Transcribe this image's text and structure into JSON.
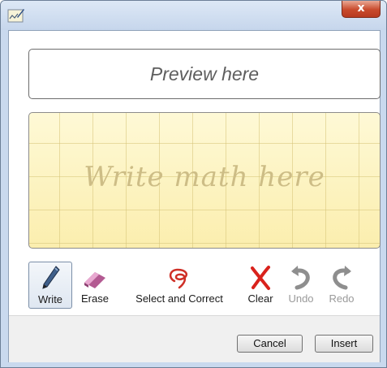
{
  "window": {
    "close_label": "x",
    "app_icon": "math-input-icon"
  },
  "preview": {
    "placeholder": "Preview here"
  },
  "writing_area": {
    "placeholder": "Write math here"
  },
  "toolbar": {
    "tools": [
      {
        "label": "Write",
        "icon": "pen-icon",
        "active": true,
        "enabled": true
      },
      {
        "label": "Erase",
        "icon": "eraser-icon",
        "active": false,
        "enabled": true
      },
      {
        "label": "Select and Correct",
        "icon": "lasso-icon",
        "active": false,
        "enabled": true
      },
      {
        "label": "Clear",
        "icon": "clear-x-icon",
        "active": false,
        "enabled": true
      },
      {
        "label": "Undo",
        "icon": "undo-icon",
        "active": false,
        "enabled": false
      },
      {
        "label": "Redo",
        "icon": "redo-icon",
        "active": false,
        "enabled": false
      }
    ]
  },
  "buttons": {
    "cancel": "Cancel",
    "insert": "Insert"
  },
  "colors": {
    "writing_area_bg": "#fdf6c4",
    "clear_icon": "#d9221c"
  }
}
